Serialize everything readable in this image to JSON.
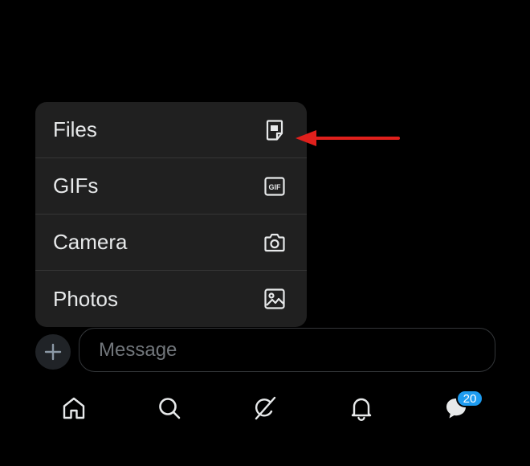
{
  "colors": {
    "background": "#000000",
    "menu_background": "#202020",
    "annotation_arrow": "#e0201c",
    "badge": "#1d9bf0",
    "placeholder": "#71767b"
  },
  "attach_menu": {
    "items": [
      {
        "label": "Files",
        "icon": "file-icon"
      },
      {
        "label": "GIFs",
        "icon": "gif-icon"
      },
      {
        "label": "Camera",
        "icon": "camera-icon"
      },
      {
        "label": "Photos",
        "icon": "image-icon"
      }
    ]
  },
  "composer": {
    "add_icon": "plus-icon",
    "placeholder": "Message",
    "value": ""
  },
  "bottom_nav": {
    "items": [
      {
        "icon": "home-icon"
      },
      {
        "icon": "search-icon"
      },
      {
        "icon": "grok-icon"
      },
      {
        "icon": "bell-icon"
      },
      {
        "icon": "messages-icon"
      }
    ],
    "messages_badge": "20"
  }
}
